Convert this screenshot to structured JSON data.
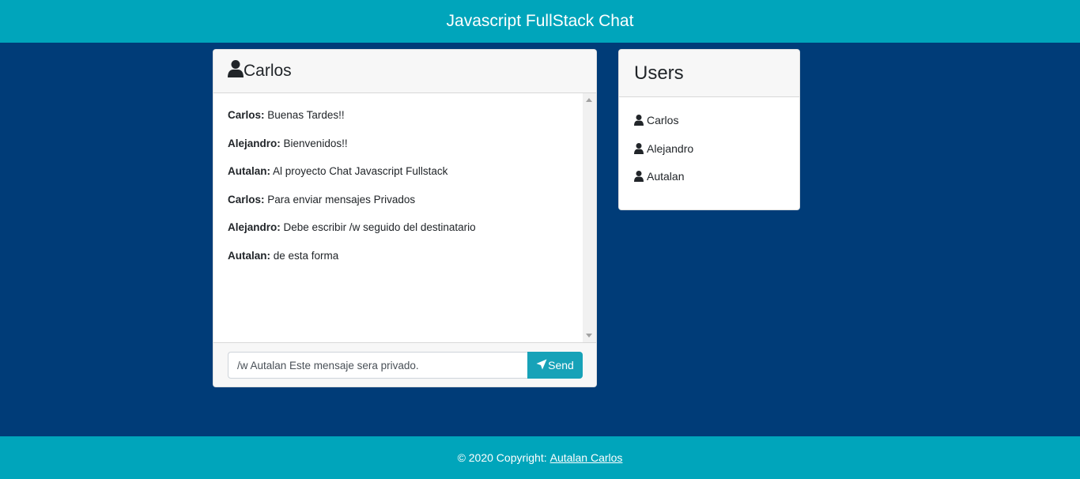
{
  "header": {
    "title": "Javascript FullStack Chat"
  },
  "chat": {
    "current_user": "Carlos",
    "messages": [
      {
        "author": "Carlos:",
        "text": "Buenas Tardes!!"
      },
      {
        "author": "Alejandro:",
        "text": "Bienvenidos!!"
      },
      {
        "author": "Autalan:",
        "text": "Al proyecto Chat Javascript Fullstack"
      },
      {
        "author": "Carlos:",
        "text": "Para enviar mensajes Privados"
      },
      {
        "author": "Alejandro:",
        "text": "Debe escribir /w seguido del destinatario"
      },
      {
        "author": "Autalan:",
        "text": "de esta forma"
      }
    ],
    "input_value": "/w Autalan Este mensaje sera privado.",
    "send_label": "Send"
  },
  "users": {
    "title": "Users",
    "list": [
      {
        "name": "Carlos"
      },
      {
        "name": "Alejandro"
      },
      {
        "name": "Autalan"
      }
    ]
  },
  "footer": {
    "copyright": "© 2020 Copyright:",
    "link_text": "Autalan Carlos"
  },
  "colors": {
    "background": "#003c78",
    "bar": "#00a5bb",
    "send_button": "#17a2b8"
  },
  "icons": {
    "user": "user-icon",
    "send": "paper-plane-icon"
  }
}
